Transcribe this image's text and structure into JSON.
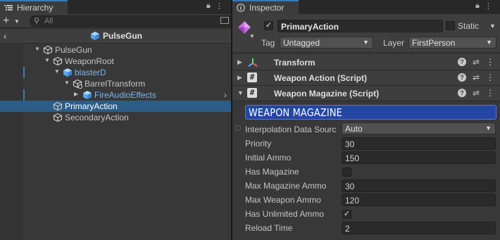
{
  "hierarchy": {
    "tab_label": "Hierarchy",
    "search_placeholder": "All",
    "prefab_title": "PulseGun",
    "tree": [
      {
        "label": "PulseGun",
        "depth": 0,
        "expanded": true,
        "kind": "gameobject",
        "selected": false
      },
      {
        "label": "WeaponRoot",
        "depth": 1,
        "expanded": true,
        "kind": "gameobject",
        "selected": false
      },
      {
        "label": "blasterD",
        "depth": 2,
        "expanded": true,
        "kind": "prefab",
        "selected": false
      },
      {
        "label": "BarrelTransform",
        "depth": 3,
        "expanded": true,
        "kind": "gameobject-added",
        "selected": false
      },
      {
        "label": "FireAudioEffects",
        "depth": 4,
        "expanded": false,
        "kind": "prefab",
        "selected": false
      },
      {
        "label": "PrimaryAction",
        "depth": 1,
        "expanded": null,
        "kind": "gameobject",
        "selected": true
      },
      {
        "label": "SecondaryAction",
        "depth": 1,
        "expanded": null,
        "kind": "gameobject",
        "selected": false
      }
    ]
  },
  "inspector": {
    "tab_label": "Inspector",
    "object_name": "PrimaryAction",
    "active": true,
    "static_label": "Static",
    "is_static": false,
    "tag_label": "Tag",
    "tag_value": "Untagged",
    "layer_label": "Layer",
    "layer_value": "FirstPerson",
    "components": [
      {
        "title": "Transform",
        "expanded": false,
        "icon": "transform-icon"
      },
      {
        "title": "Weapon Action (Script)",
        "expanded": false,
        "icon": "script-icon"
      },
      {
        "title": "Weapon Magazine (Script)",
        "expanded": true,
        "icon": "script-icon"
      }
    ],
    "banner": "WEAPON MAGAZINE",
    "properties": {
      "interpolation": {
        "label": "Interpolation Data Sourc",
        "value": "Auto"
      },
      "priority": {
        "label": "Priority",
        "value": "30"
      },
      "initial_ammo": {
        "label": "Initial Ammo",
        "value": "150"
      },
      "has_magazine": {
        "label": "Has Magazine",
        "checked": false
      },
      "max_magazine_ammo": {
        "label": "Max Magazine Ammo",
        "value": "30"
      },
      "max_weapon_ammo": {
        "label": "Max Weapon Ammo",
        "value": "120"
      },
      "has_unlimited_ammo": {
        "label": "Has Unlimited Ammo",
        "checked": true
      },
      "reload_time": {
        "label": "Reload Time",
        "value": "2"
      }
    }
  },
  "colors": {
    "selection": "#2c5d87",
    "prefab_text": "#7ab5ef",
    "banner_bg": "#2546a2",
    "tab_accent": "#3a79bb"
  }
}
